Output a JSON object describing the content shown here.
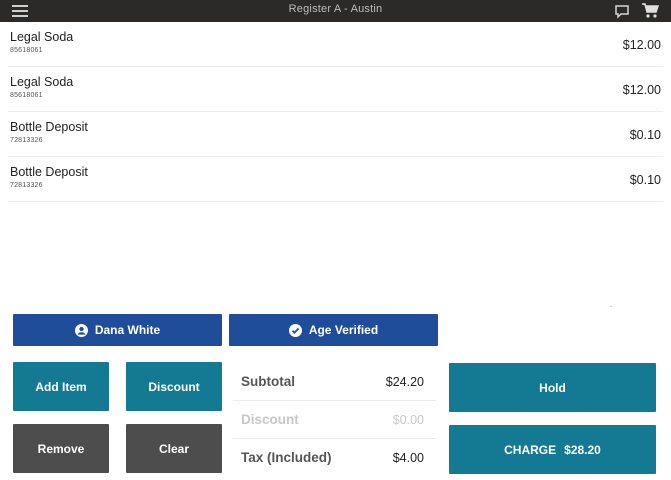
{
  "header": {
    "title": "Register A - Austin",
    "menu_icon": "hamburger-menu-icon",
    "chat_icon": "chat-bubble-icon",
    "cart_icon": "shopping-cart-icon"
  },
  "cart": {
    "items": [
      {
        "name": "Legal Soda",
        "sku": "85618061",
        "price": "$12.00"
      },
      {
        "name": "Legal Soda",
        "sku": "85618061",
        "price": "$12.00"
      },
      {
        "name": "Bottle Deposit",
        "sku": "72813326",
        "price": "$0.10"
      },
      {
        "name": "Bottle Deposit",
        "sku": "72813326",
        "price": "$0.10"
      }
    ]
  },
  "customer": {
    "label": "Dana White",
    "icon": "user-circle-icon"
  },
  "age": {
    "label": "Age Verified",
    "icon": "check-circle-icon"
  },
  "actions": {
    "add_item": "Add Item",
    "discount": "Discount",
    "remove": "Remove",
    "clear": "Clear",
    "hold": "Hold",
    "charge": "CHARGE",
    "charge_amount": "$28.20"
  },
  "totals": {
    "subtotal_label": "Subtotal",
    "subtotal_value": "$24.20",
    "discount_label": "Discount",
    "discount_value": "$0.00",
    "tax_label": "Tax (Included)",
    "tax_value": "$4.00"
  },
  "colors": {
    "topbar": "#2b2a28",
    "blue": "#204d99",
    "teal": "#147a93",
    "gray": "#4d4d4d"
  }
}
